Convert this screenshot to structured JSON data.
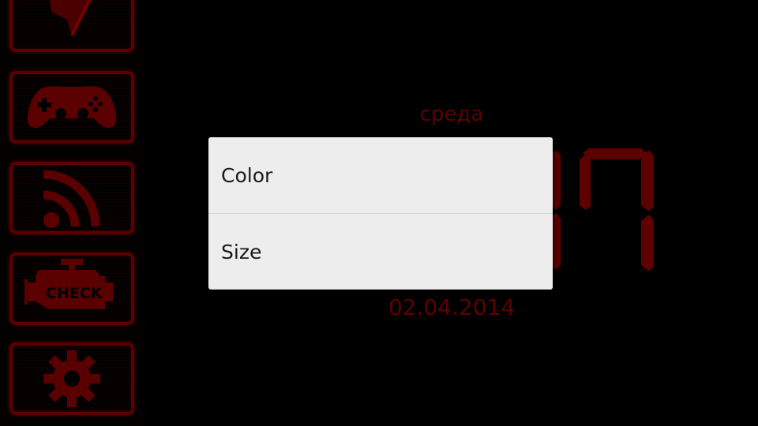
{
  "sidebar": {
    "items": [
      {
        "icon": "navigation-arrow-icon"
      },
      {
        "icon": "gamepad-icon"
      },
      {
        "icon": "rss-icon"
      },
      {
        "icon": "check-engine-icon",
        "label": "CHECK"
      },
      {
        "icon": "gear-icon"
      }
    ]
  },
  "clock": {
    "weekday": "среда",
    "time_fragment": "17",
    "date": "02.04.2014"
  },
  "dialog": {
    "items": [
      {
        "label": "Color"
      },
      {
        "label": "Size"
      }
    ]
  },
  "colors": {
    "accent": "#7a0000",
    "dialog_bg": "#ededed",
    "text_dim_red": "#5e0000"
  }
}
